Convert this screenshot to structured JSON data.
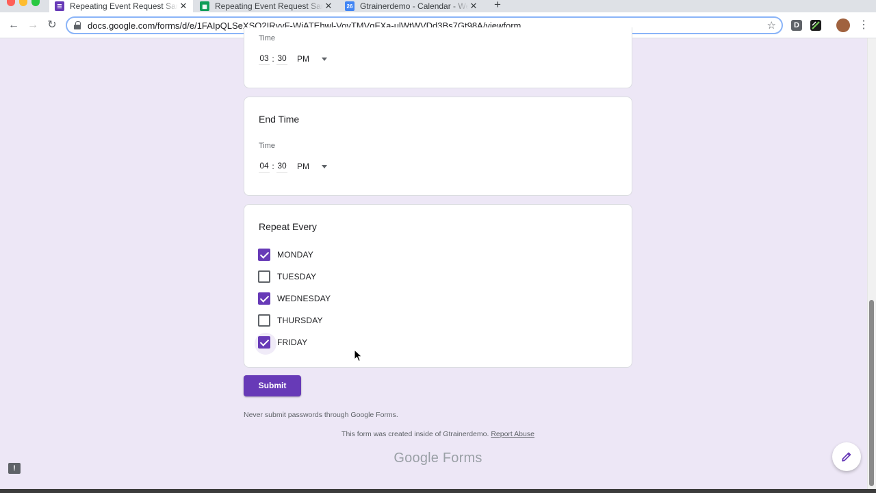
{
  "browser": {
    "tabs": [
      {
        "title": "Repeating Event Request Samp",
        "favicon": "forms-icon",
        "color": "#673ab7",
        "active": true
      },
      {
        "title": "Repeating Event Request Samp",
        "favicon": "sheets-icon",
        "color": "#0f9d58",
        "active": false
      },
      {
        "title": "Gtrainerdemo - Calendar - We",
        "favicon": "calendar-icon",
        "favicon_text": "26",
        "color": "#4285f4",
        "active": false
      }
    ],
    "url": "docs.google.com/forms/d/e/1FAIpQLSeXSQ2IRyvF-WiATEhwl-VovTMVqFXa-ulWtWVDd3Bs7Gt98A/viewform",
    "extension_label": "D"
  },
  "form": {
    "start_time": {
      "label": "Time",
      "hour": "03",
      "minute": "30",
      "ampm": "PM"
    },
    "end_time": {
      "title": "End Time",
      "label": "Time",
      "hour": "04",
      "minute": "30",
      "ampm": "PM"
    },
    "repeat": {
      "title": "Repeat Every",
      "options": [
        {
          "label": "MONDAY",
          "checked": true
        },
        {
          "label": "TUESDAY",
          "checked": false
        },
        {
          "label": "WEDNESDAY",
          "checked": true
        },
        {
          "label": "THURSDAY",
          "checked": false
        },
        {
          "label": "FRIDAY",
          "checked": true
        }
      ]
    },
    "submit_label": "Submit",
    "password_notice": "Never submit passwords through Google Forms.",
    "created_text": "This form was created inside of Gtrainerdemo.",
    "report_abuse": "Report Abuse",
    "brand_google": "Google",
    "brand_forms": "Forms",
    "accent_color": "#673ab7"
  }
}
